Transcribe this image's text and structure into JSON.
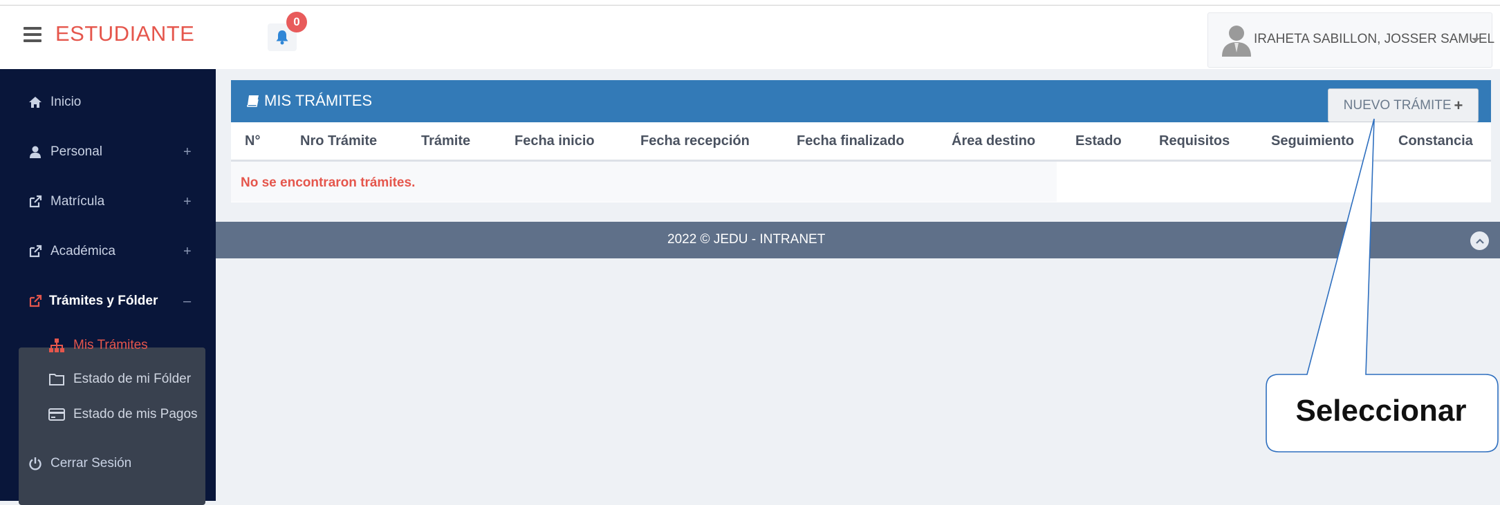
{
  "header": {
    "brand": "ESTUDIANTE",
    "notifications_count": "0",
    "user_name": "IRAHETA SABILLON, JOSSER SAMUEL"
  },
  "sidebar": {
    "items": [
      {
        "label": "Inicio",
        "icon": "home-icon"
      },
      {
        "label": "Personal",
        "icon": "user-icon",
        "toggle": "+"
      },
      {
        "label": "Matrícula",
        "icon": "external-link-icon",
        "toggle": "+"
      },
      {
        "label": "Académica",
        "icon": "external-link-icon",
        "toggle": "+"
      },
      {
        "label": "Trámites y Fólder",
        "icon": "external-link-icon",
        "toggle": "–"
      },
      {
        "label": "Cerrar Sesión",
        "icon": "power-icon"
      }
    ],
    "subitems": [
      {
        "label": "Mis Trámites",
        "icon": "sitemap-icon",
        "active": true
      },
      {
        "label": "Estado de mi Fólder",
        "icon": "folder-icon"
      },
      {
        "label": "Estado de mis Pagos",
        "icon": "credit-card-icon"
      }
    ]
  },
  "panel": {
    "title": "MIS TRÁMITES",
    "new_button": "NUEVO TRÁMITE",
    "columns": [
      "N°",
      "Nro Trámite",
      "Trámite",
      "Fecha inicio",
      "Fecha recepción",
      "Fecha finalizado",
      "Área destino",
      "Estado",
      "Requisitos",
      "Seguimiento",
      "Constancia"
    ],
    "empty_message": "No se encontraron trámites."
  },
  "footer": {
    "text": "2022 © JEDU - INTRANET"
  },
  "annotation": {
    "label": "Seleccionar"
  },
  "colors": {
    "brand": "#e5564c",
    "sidebar": "#09163a",
    "panel_header": "#337ab7",
    "footer": "#5f7089"
  }
}
